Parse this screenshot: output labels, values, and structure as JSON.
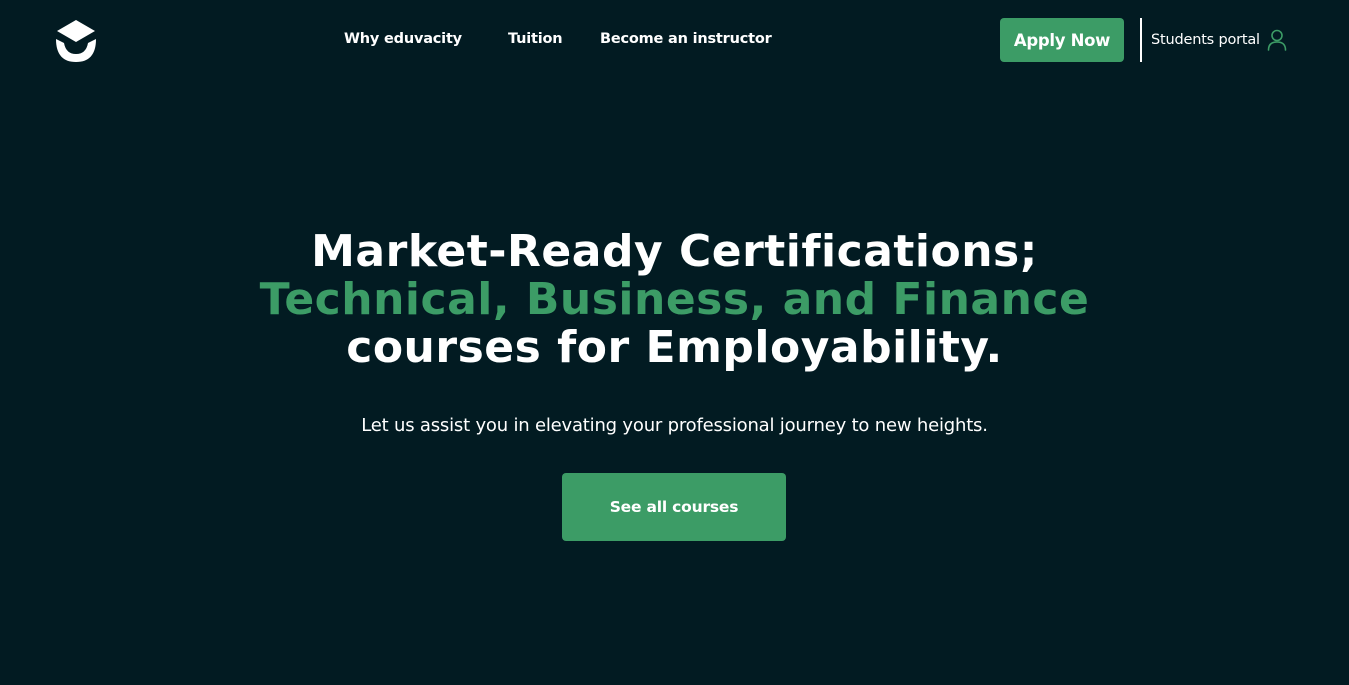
{
  "header": {
    "logo_icon": "graduation-cap-smile-logo-icon",
    "nav": [
      {
        "label": "Why eduvacity"
      },
      {
        "label": "Tuition"
      },
      {
        "label": "Become an instructor"
      }
    ],
    "apply_label": "Apply Now",
    "portal_label": "Students portal",
    "portal_icon": "user-icon"
  },
  "hero": {
    "title_line1": "Market-Ready Certifications;",
    "title_line2": "Technical, Business, and Finance",
    "title_line3": "courses for Employability.",
    "subtitle": "Let us assist you in elevating your professional journey to new heights.",
    "cta_label": "See all courses"
  },
  "colors": {
    "background": "#021b22",
    "accent": "#3c9c66",
    "text": "#ffffff"
  }
}
